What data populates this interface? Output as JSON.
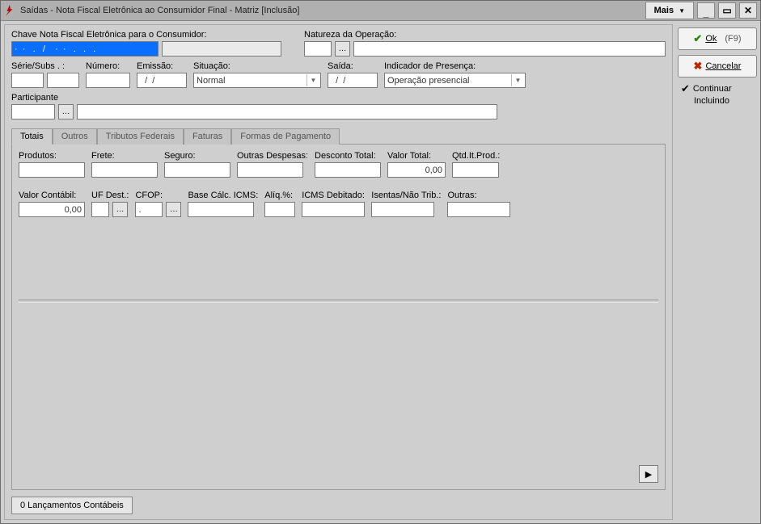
{
  "titlebar": {
    "title": "Saídas -  Nota Fiscal Eletrônica ao Consumidor Final - Matriz [Inclusão]",
    "mais": "Mais"
  },
  "side": {
    "ok_label": "Ok",
    "ok_key": "(F9)",
    "cancel_label": "Cancelar",
    "continuar1": "Continuar",
    "continuar2": "Incluindo"
  },
  "header": {
    "chave_label": "Chave Nota Fiscal Eletrônica para o Consumidor:",
    "chave_value": "·  ·   .   /    ·  ·   .   .   .",
    "natureza_label": "Natureza da Operação:",
    "natureza_code": "",
    "natureza_desc": ""
  },
  "row2": {
    "serie_label": "Série/Subs . :",
    "serie_value": "",
    "subs_value": "",
    "numero_label": "Número:",
    "numero_value": "",
    "emissao_label": "Emissão:",
    "emissao_value": "  /  /",
    "situacao_label": "Situação:",
    "situacao_value": "Normal",
    "saida_label": "Saída:",
    "saida_value": "  /  /",
    "indicador_label": "Indicador de Presença:",
    "indicador_value": "Operação presencial"
  },
  "participante": {
    "label": "Participante",
    "code": "",
    "desc": ""
  },
  "tabs": {
    "t0": "Totais",
    "t1": "Outros",
    "t2": "Tributos Federais",
    "t3": "Faturas",
    "t4": "Formas de Pagamento"
  },
  "totais_row1": {
    "produtos_label": "Produtos:",
    "produtos_value": "",
    "frete_label": "Frete:",
    "frete_value": "",
    "seguro_label": "Seguro:",
    "seguro_value": "",
    "outras_label": "Outras Despesas:",
    "outras_value": "",
    "desconto_label": "Desconto Total:",
    "desconto_value": "",
    "valor_total_label": "Valor Total:",
    "valor_total_value": "0,00",
    "qtd_label": "Qtd.It.Prod.:",
    "qtd_value": ""
  },
  "totais_row2": {
    "valor_contabil_label": "Valor Contábil:",
    "valor_contabil_value": "0,00",
    "uf_label": "UF Dest.:",
    "uf_value": "",
    "cfop_label": "CFOP:",
    "cfop_value": ".",
    "base_label": "Base Cálc. ICMS:",
    "base_value": "",
    "aliq_label": "Alíq.%:",
    "aliq_value": "",
    "icms_label": "ICMS Debitado:",
    "icms_value": "",
    "isentas_label": "Isentas/Não Trib.:",
    "isentas_value": "",
    "outras2_label": "Outras:",
    "outras2_value": ""
  },
  "bottom": {
    "lancamentos": "0 Lançamentos Contábeis"
  }
}
